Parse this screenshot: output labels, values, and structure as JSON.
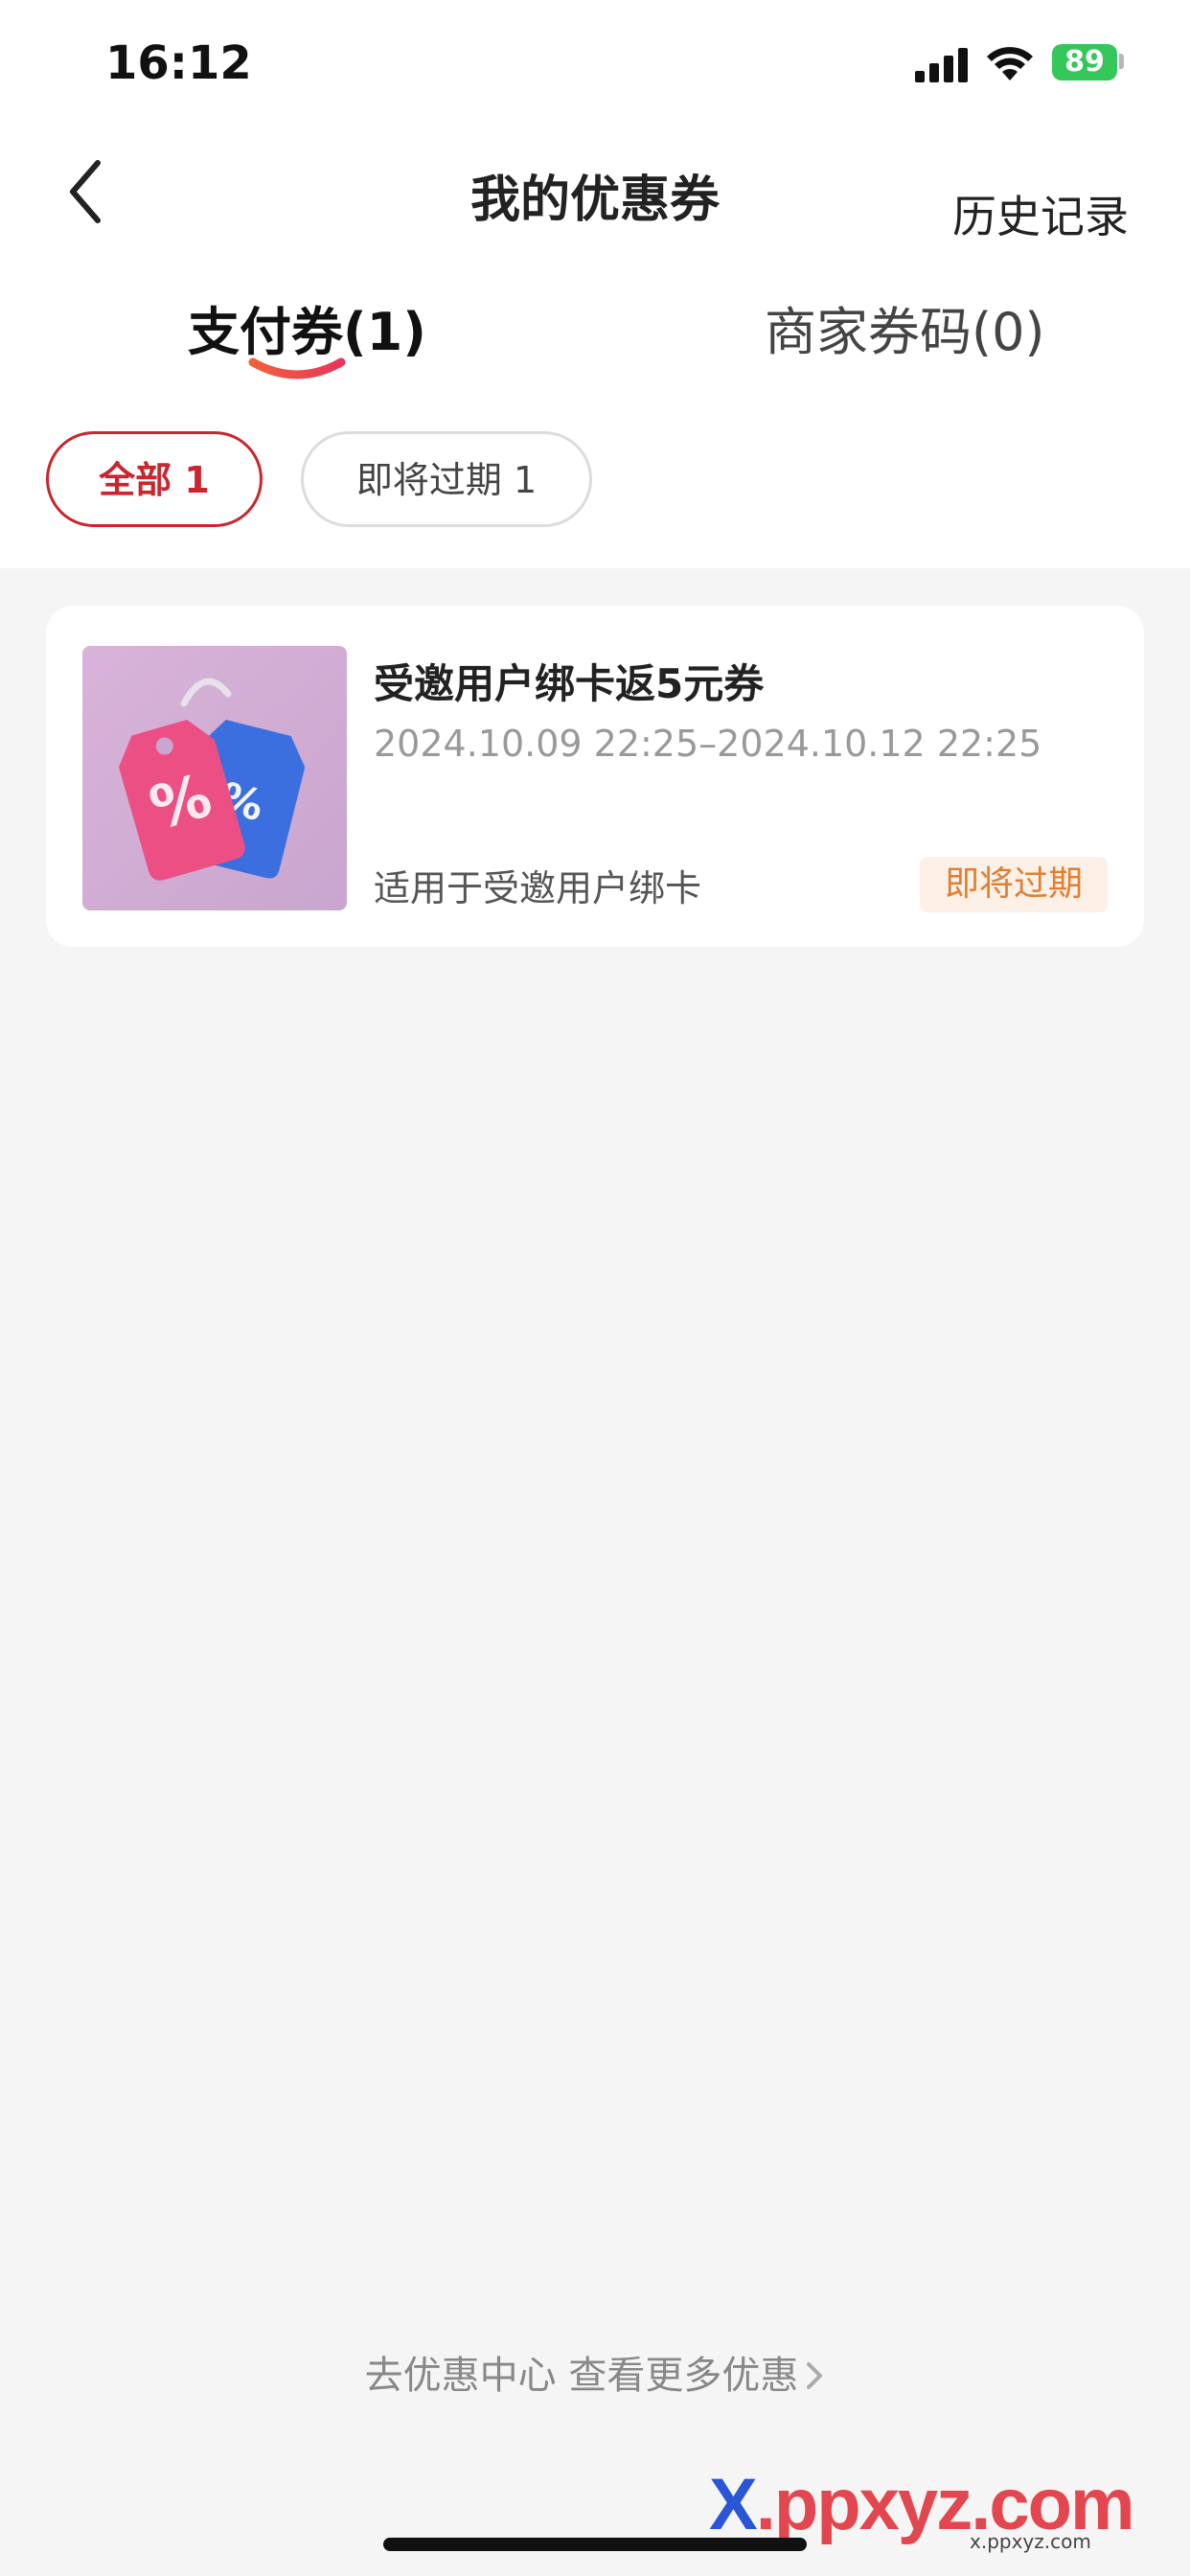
{
  "status_bar": {
    "time": "16:12",
    "battery": "89",
    "icons": [
      "signal-icon",
      "wifi-icon",
      "battery-icon"
    ]
  },
  "nav": {
    "back_icon": "chevron-left-icon",
    "title": "我的优惠券",
    "history_label": "历史记录"
  },
  "tabs": [
    {
      "label": "支付券(1)",
      "active": true
    },
    {
      "label": "商家券码(0)",
      "active": false
    }
  ],
  "filters": [
    {
      "label": "全部 1",
      "active": true
    },
    {
      "label": "即将过期 1",
      "active": false
    }
  ],
  "coupon": {
    "title": "受邀用户绑卡返5元券",
    "validity": "2024.10.09 22:25–2024.10.12 22:25",
    "description": "适用于受邀用户绑卡",
    "badge": "即将过期",
    "thumbnail_icon": "discount-tag-icon"
  },
  "footer": {
    "link_label": "去优惠中心 查看更多优惠",
    "icon": "chevron-right-icon"
  },
  "watermark": {
    "x_letter": "X",
    "rest": ".ppxyz.com",
    "sub": "x.ppxyz.com"
  },
  "colors": {
    "accent_red": "#c9262e",
    "badge_orange": "#e07f33",
    "badge_bg": "#fdf0e6",
    "page_bg": "#f5f5f5"
  }
}
